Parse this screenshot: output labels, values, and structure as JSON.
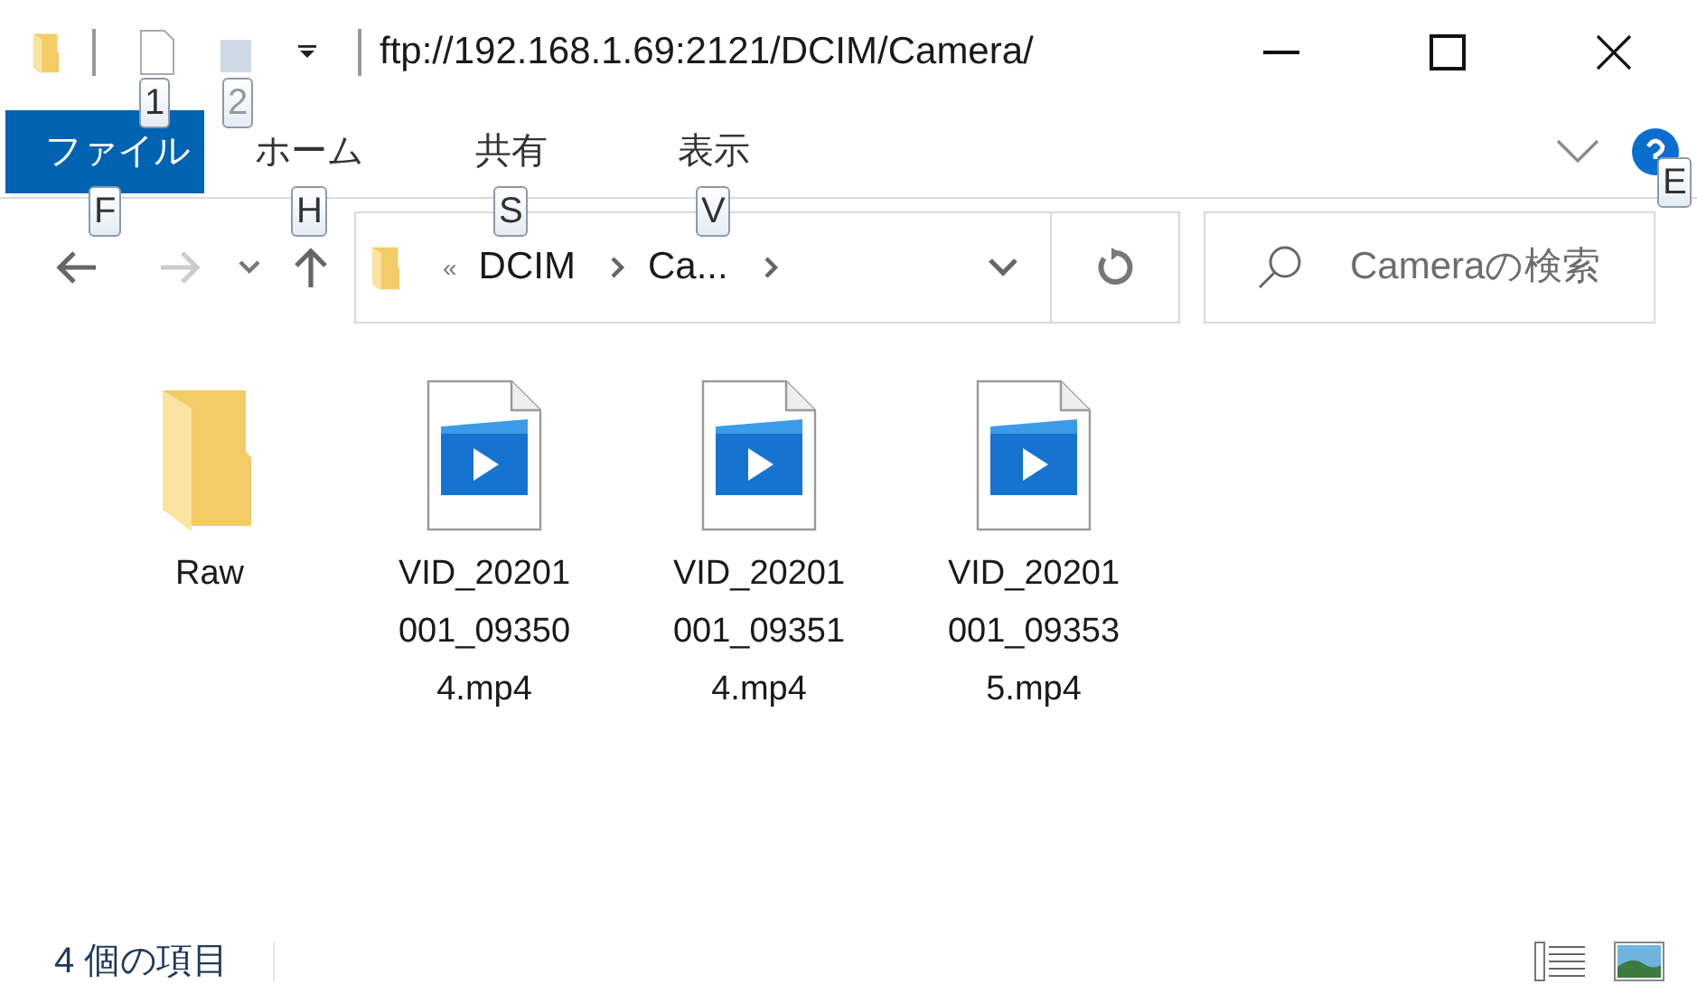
{
  "window": {
    "title": "ftp://192.168.1.69:2121/DCIM/Camera/"
  },
  "quick_access": {
    "key_tips": [
      "1",
      "2"
    ]
  },
  "ribbon": {
    "tabs": [
      {
        "label": "ファイル",
        "key_tip": "F",
        "selected": true
      },
      {
        "label": "ホーム",
        "key_tip": "H",
        "selected": false
      },
      {
        "label": "共有",
        "key_tip": "S",
        "selected": false
      },
      {
        "label": "表示",
        "key_tip": "V",
        "selected": false
      }
    ],
    "help_key_tip": "E"
  },
  "navigation": {
    "back_disabled": false,
    "forward_disabled": true,
    "overflow": "«",
    "breadcrumbs": [
      "DCIM",
      "Ca..."
    ],
    "search": {
      "placeholder": "Cameraの検索"
    }
  },
  "items": [
    {
      "kind": "folder",
      "name": "Raw"
    },
    {
      "kind": "video",
      "name": "VID_20201001_093504.mp4"
    },
    {
      "kind": "video",
      "name": "VID_20201001_093514.mp4"
    },
    {
      "kind": "video",
      "name": "VID_20201001_093535.mp4"
    }
  ],
  "status_bar": {
    "count": "4 個の項目"
  }
}
